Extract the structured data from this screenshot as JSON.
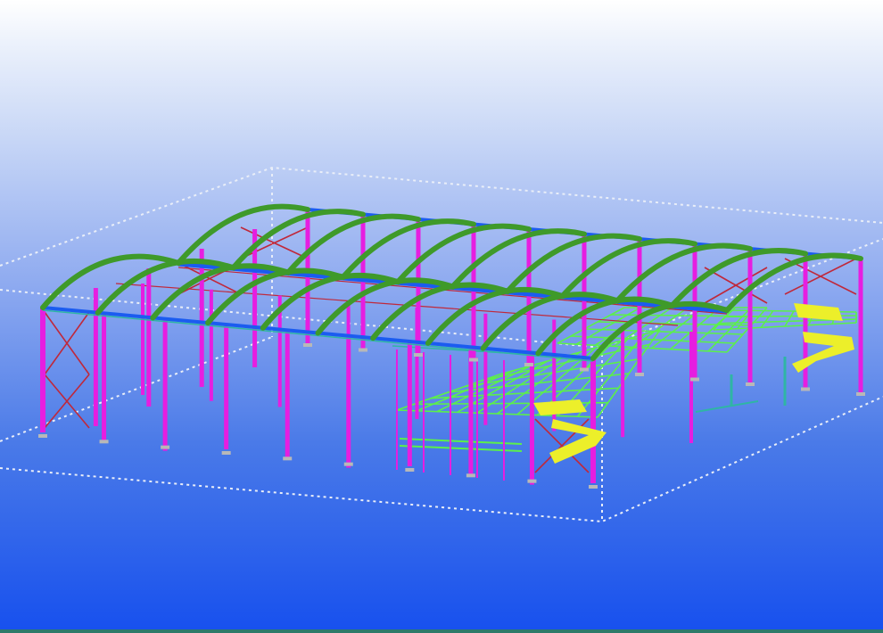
{
  "viewport": {
    "background_top": "#ffffff",
    "background_bottom": "#1750ee"
  },
  "model": {
    "colors": {
      "column": "#e61ee0",
      "rafter": "#3f9a2a",
      "eave_beam": "#1b5cf0",
      "bracing": "#c0283a",
      "floor_grid": "#5cf04a",
      "stair": "#ecef2a",
      "secondary": "#2fb5a5",
      "work_area_box": "#e9eef8",
      "base_plate": "#b8b8b8"
    },
    "objects": [
      "columns",
      "portal-rafters",
      "eave-beams",
      "wall-bracing",
      "mezzanine-floors",
      "stairs",
      "work-area-box"
    ]
  }
}
